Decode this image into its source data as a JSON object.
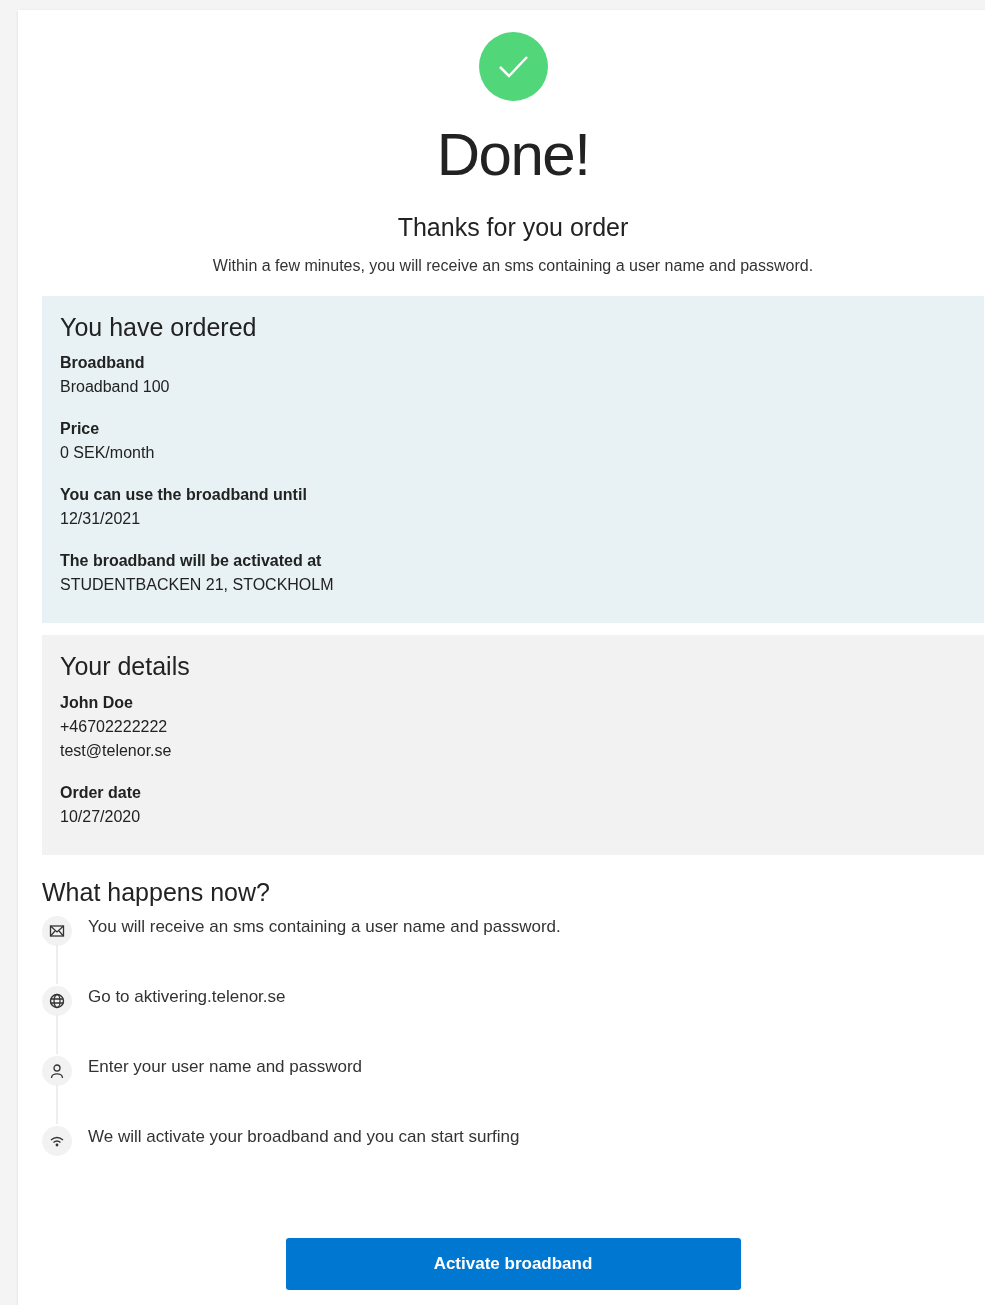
{
  "header": {
    "title": "Done!",
    "subtitle": "Thanks for you order",
    "message": "Within a few minutes, you will receive an sms containing a user name and password."
  },
  "order": {
    "title": "You have ordered",
    "fields": [
      {
        "label": "Broadband",
        "value": "Broadband 100"
      },
      {
        "label": "Price",
        "value": "0 SEK/month"
      },
      {
        "label": "You can use the broadband until",
        "value": "12/31/2021"
      },
      {
        "label": "The broadband will be activated at",
        "value": "STUDENTBACKEN 21, STOCKHOLM"
      }
    ]
  },
  "details": {
    "title": "Your details",
    "name": "John Doe",
    "phone": "+46702222222",
    "email": "test@telenor.se",
    "fields": [
      {
        "label": "Order date",
        "value": "10/27/2020"
      }
    ]
  },
  "next_steps": {
    "title": "What happens now?",
    "steps": [
      {
        "kind": "mail",
        "text": "You will receive an sms containing a user name and password."
      },
      {
        "kind": "web",
        "text": "Go to aktivering.telenor.se"
      },
      {
        "kind": "user",
        "text": "Enter your user name and password"
      },
      {
        "kind": "wifi",
        "text": "We will activate your broadband and you can start surfing"
      }
    ]
  },
  "button": "Activate broadband"
}
